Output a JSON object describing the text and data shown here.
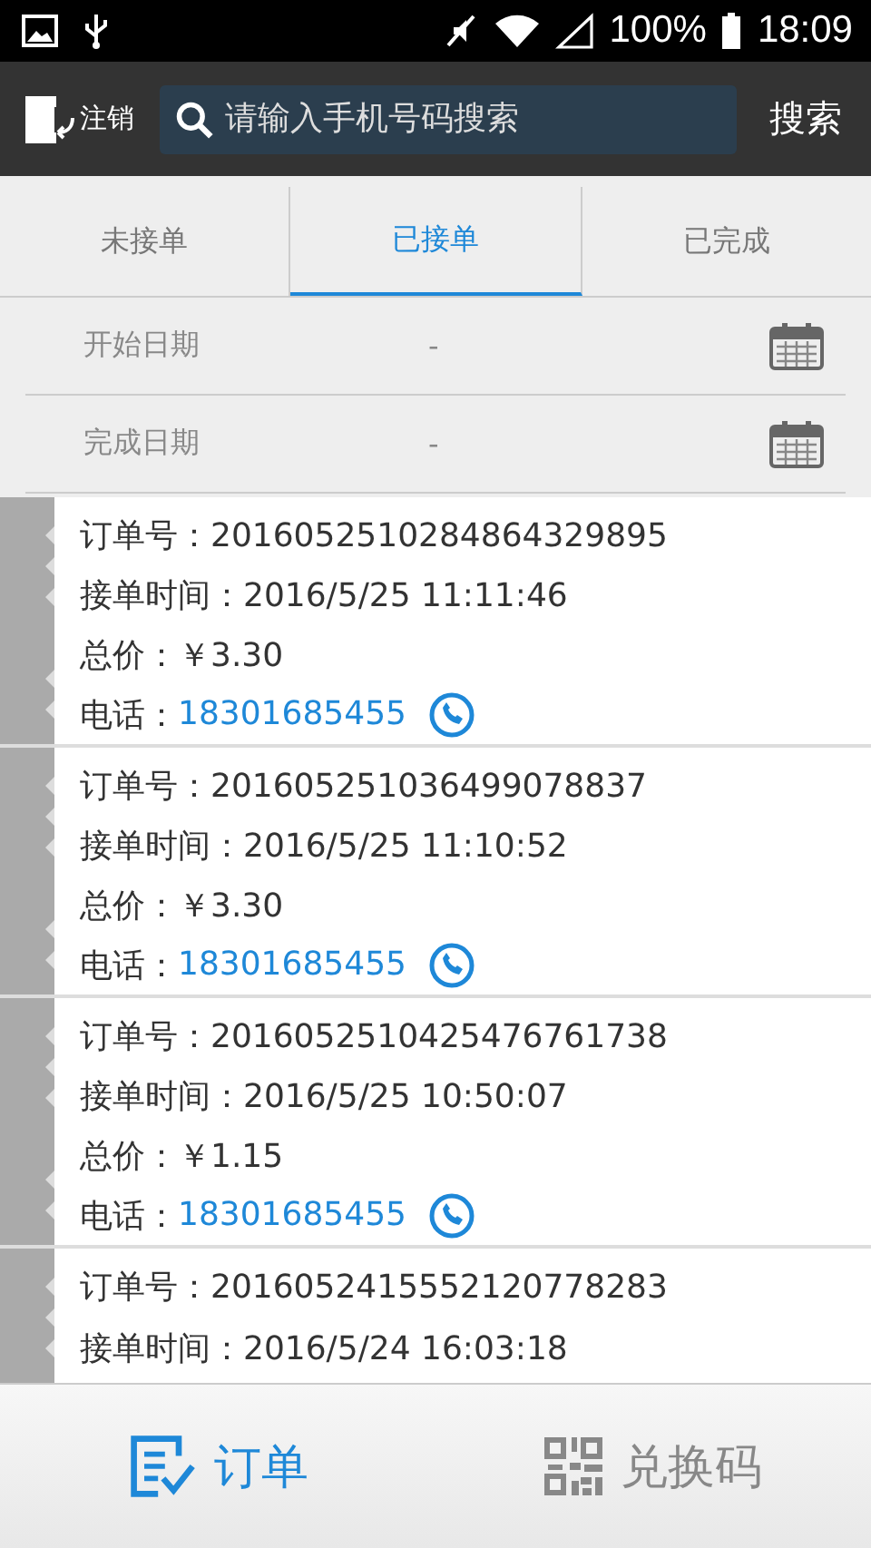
{
  "status_bar": {
    "battery": "100%",
    "time": "18:09"
  },
  "top_bar": {
    "logout": "注销",
    "search": {
      "placeholder": "请输入手机号码搜索"
    },
    "search_button": "搜索"
  },
  "tabs": [
    {
      "label": "未接单",
      "selected": false
    },
    {
      "label": "已接单",
      "selected": true
    },
    {
      "label": "已完成",
      "selected": false
    }
  ],
  "date_filters": [
    {
      "label": "开始日期",
      "value": "-"
    },
    {
      "label": "完成日期",
      "value": "-"
    }
  ],
  "orders": [
    {
      "order_no": "订单号：2016052510284864329895",
      "time": "接单时间：2016/5/25 11:11:46",
      "price": "总价：￥3.30",
      "phone_label": "电话：",
      "phone": "18301685455"
    },
    {
      "order_no": "订单号：201605251036499078837",
      "time": "接单时间：2016/5/25 11:10:52",
      "price": "总价：￥3.30",
      "phone_label": "电话：",
      "phone": "18301685455"
    },
    {
      "order_no": "订单号：2016052510425476761738",
      "time": "接单时间：2016/5/25 10:50:07",
      "price": "总价：￥1.15",
      "phone_label": "电话：",
      "phone": "18301685455"
    },
    {
      "order_no": "订单号：2016052415552120778283",
      "time": "接单时间：2016/5/24 16:03:18"
    }
  ],
  "bottom_nav": [
    {
      "label": "订单",
      "kind": "orders",
      "selected": true
    },
    {
      "label": "兑换码",
      "kind": "code",
      "selected": false
    }
  ]
}
